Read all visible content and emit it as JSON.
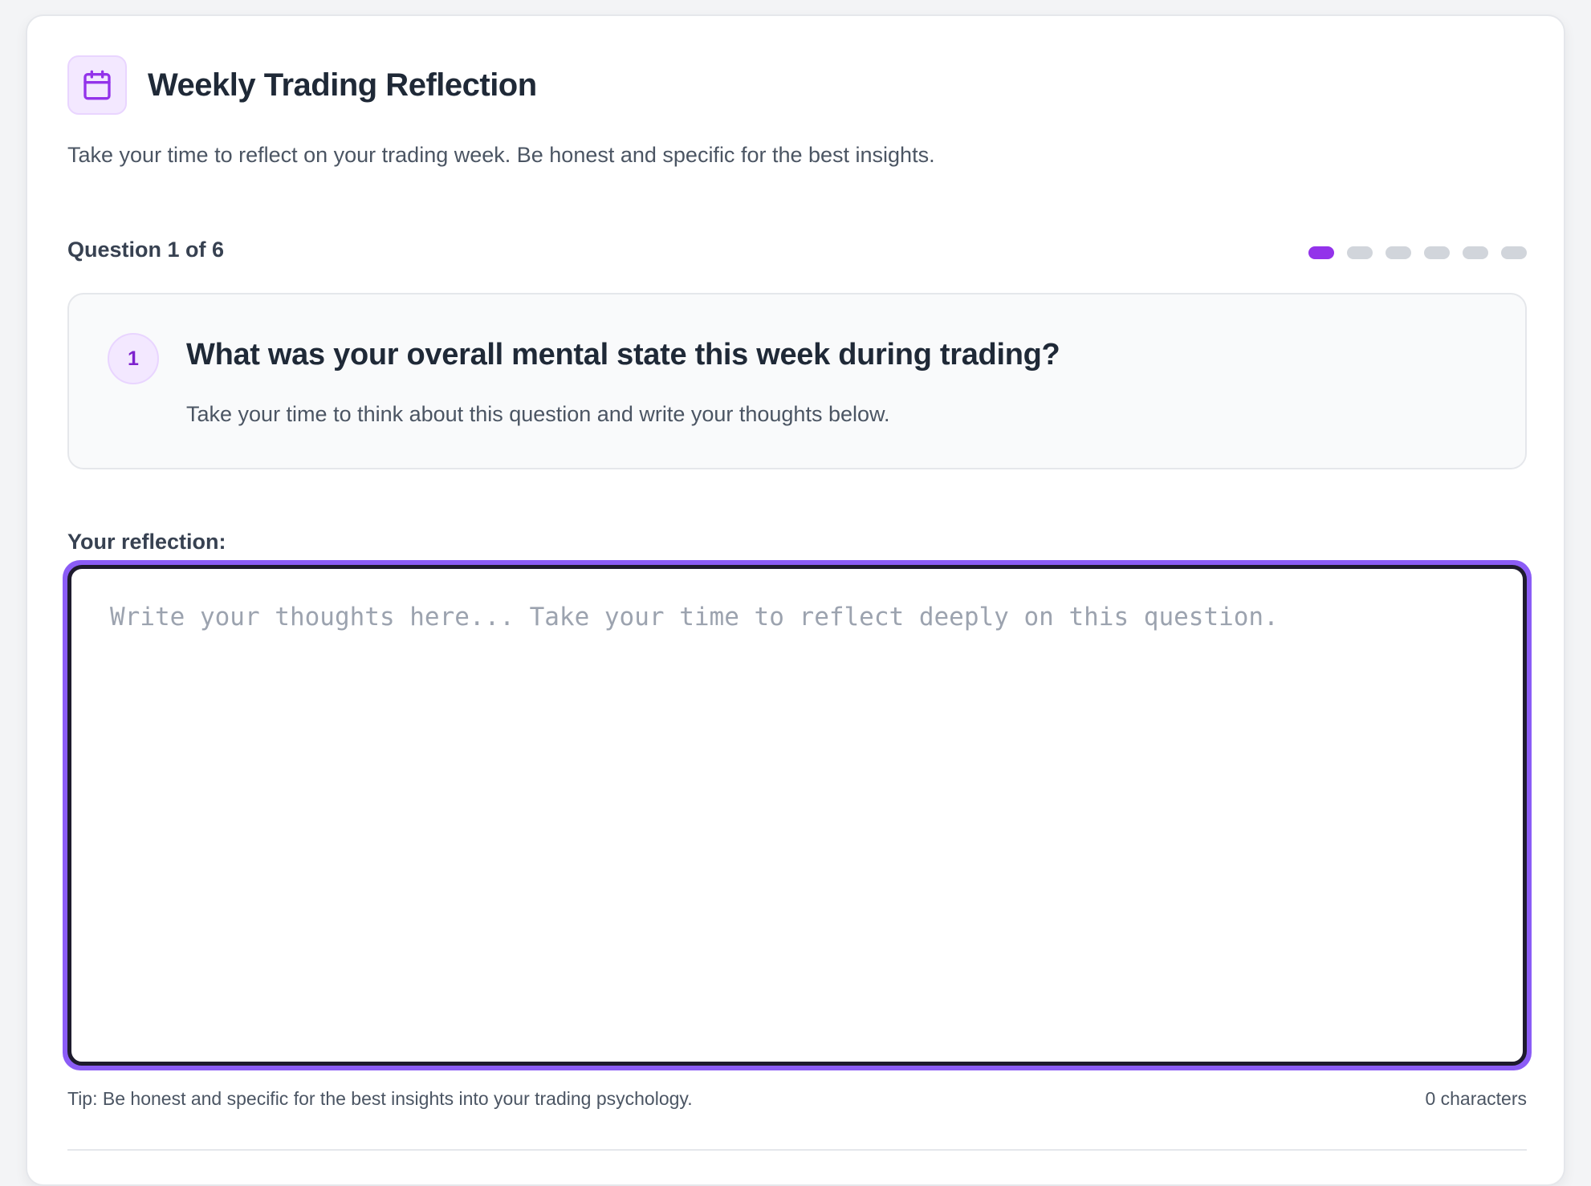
{
  "header": {
    "icon": "calendar-icon",
    "title": "Weekly Trading Reflection",
    "subtitle": "Take your time to reflect on your trading week. Be honest and specific for the best insights."
  },
  "progress": {
    "label": "Question 1 of 6",
    "current": 1,
    "total": 6
  },
  "question": {
    "number": "1",
    "text": "What was your overall mental state this week during trading?",
    "help": "Take your time to think about this question and write your thoughts below."
  },
  "reflection": {
    "label": "Your reflection:",
    "value": "",
    "placeholder": "Write your thoughts here... Take your time to reflect deeply on this question.",
    "tip": "Tip: Be honest and specific for the best insights into your trading psychology.",
    "char_count": "0 characters"
  },
  "colors": {
    "accent": "#9333ea",
    "focus_ring": "#8b5cf6",
    "inactive_dot": "#d1d5db"
  }
}
